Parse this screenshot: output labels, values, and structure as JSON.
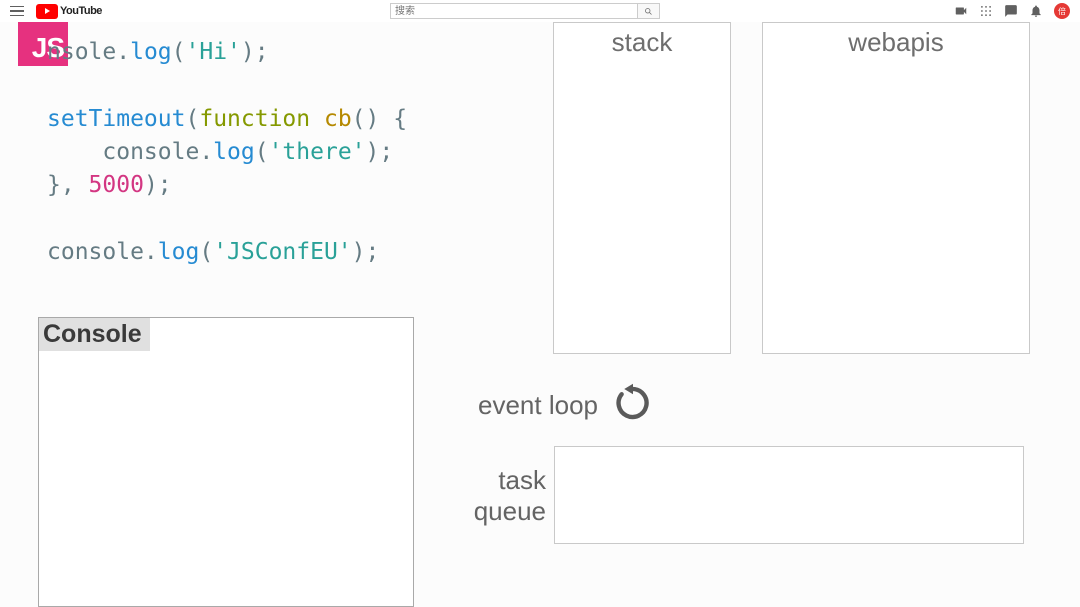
{
  "header": {
    "logo_text": "YouTube",
    "search_placeholder": "搜索",
    "avatar_initials": "倍"
  },
  "diagram": {
    "js_badge": "JS",
    "code": {
      "line1_pre": "nsole.",
      "line1_log": "log",
      "line1_open": "(",
      "line1_str": "'Hi'",
      "line1_close": ");",
      "line3_func": "setTimeout",
      "line3_open": "(",
      "line3_kw": "function",
      "line3_name": " cb",
      "line3_rest": "() {",
      "line4_indent": "    console.",
      "line4_log": "log",
      "line4_open": "(",
      "line4_str": "'there'",
      "line4_close": ");",
      "line5_pre": "}, ",
      "line5_num": "5000",
      "line5_close": ");",
      "line7_pre": "console.",
      "line7_log": "log",
      "line7_open": "(",
      "line7_str": "'JSConfEU'",
      "line7_close": ");"
    },
    "console_title": "Console",
    "stack_title": "stack",
    "webapis_title": "webapis",
    "event_loop_label": "event loop",
    "task_queue_label": "task queue"
  }
}
